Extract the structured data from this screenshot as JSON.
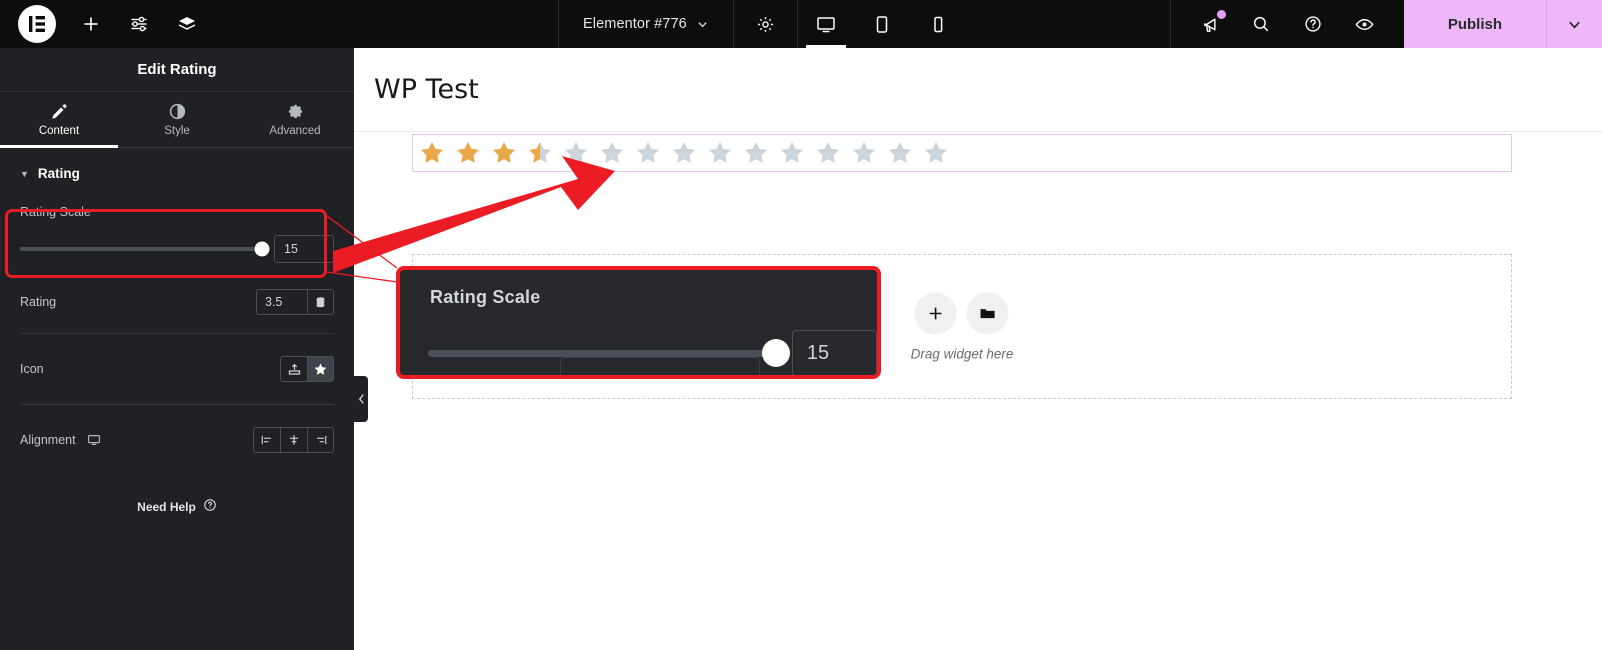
{
  "topbar": {
    "logo_icon": "elementor-logo-icon",
    "add_icon": "plus-icon",
    "settings_sliders_icon": "sliders-icon",
    "layers_icon": "layers-icon",
    "document_title": "Elementor #776",
    "document_chevron_icon": "chevron-down-icon",
    "page_settings_icon": "gear-icon",
    "devices": [
      {
        "name": "desktop",
        "icon": "desktop-icon",
        "active": true
      },
      {
        "name": "tablet",
        "icon": "tablet-icon",
        "active": false
      },
      {
        "name": "mobile",
        "icon": "mobile-icon",
        "active": false
      }
    ],
    "right_icons": [
      {
        "name": "whats-new-megaphone-icon",
        "badge": true
      },
      {
        "name": "search-icon",
        "badge": false
      },
      {
        "name": "help-icon",
        "badge": false
      },
      {
        "name": "preview-eye-icon",
        "badge": false
      }
    ],
    "publish_label": "Publish",
    "publish_chevron_icon": "chevron-down-icon",
    "publish_color": "#edb7fa"
  },
  "sidebar": {
    "panel_title": "Edit Rating",
    "tabs": [
      {
        "label": "Content",
        "icon": "pencil-icon",
        "active": true
      },
      {
        "label": "Style",
        "icon": "half-circle-icon",
        "active": false
      },
      {
        "label": "Advanced",
        "icon": "gear-icon",
        "active": false
      }
    ],
    "section": {
      "title": "Rating",
      "caret_icon": "caret-down-icon"
    },
    "controls": {
      "rating_scale": {
        "label": "Rating Scale",
        "value": "15",
        "slider_percent": 100
      },
      "rating": {
        "label": "Rating",
        "value": "3.5",
        "dynamic_icon": "database-stack-icon"
      },
      "icon": {
        "label": "Icon",
        "options": [
          {
            "name": "upload-icon",
            "active": false
          },
          {
            "name": "star-icon",
            "active": true
          }
        ]
      },
      "alignment": {
        "label": "Alignment",
        "device_icon": "desktop-icon",
        "options": [
          {
            "name": "align-left-icon",
            "active": false
          },
          {
            "name": "align-center-icon",
            "active": false
          },
          {
            "name": "align-right-icon",
            "active": false
          }
        ]
      }
    },
    "need_help": {
      "label": "Need Help",
      "icon": "question-circle-icon"
    },
    "collapse_icon": "chevron-left-icon"
  },
  "canvas": {
    "page_title": "WP Test",
    "rating_widget": {
      "scale": 15,
      "rating": 3.5,
      "filled_count": 3,
      "half_count": 1,
      "empty_count": 11,
      "filled_color": "#e8a84a",
      "empty_color": "#ccd4dc",
      "selection_border_color": "#e8c6f0"
    },
    "drop_area": {
      "add_icon": "plus-icon",
      "folder_icon": "folder-icon",
      "label": "Drag widget here"
    }
  },
  "callout": {
    "label": "Rating Scale",
    "value": "15",
    "border_color": "#ec1c24",
    "background": "#26282b"
  },
  "annotations": {
    "highlight_color": "#ec1c24",
    "arrow_color": "#ec1c24"
  }
}
